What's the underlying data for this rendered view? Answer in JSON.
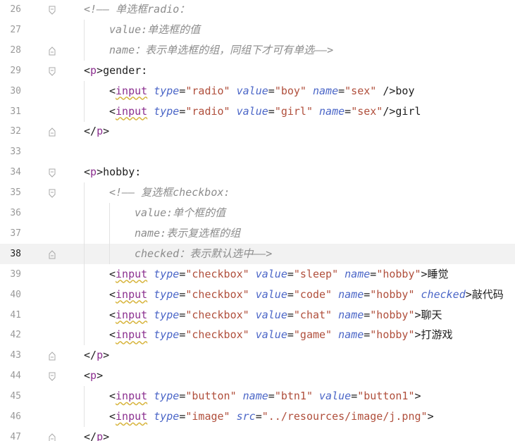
{
  "editor": {
    "current_line": 38,
    "lines": [
      {
        "number": 26,
        "indent": 1,
        "fold": "start",
        "tokens": [
          [
            "c",
            "<!—— 单选框radio："
          ]
        ]
      },
      {
        "number": 27,
        "indent": 2,
        "fold": "",
        "tokens": [
          [
            "c",
            "value:单选框的值"
          ]
        ]
      },
      {
        "number": 28,
        "indent": 2,
        "fold": "end",
        "tokens": [
          [
            "c",
            "name：表示单选框的组，同组下才可有单选——>"
          ]
        ]
      },
      {
        "number": 29,
        "indent": 1,
        "fold": "start",
        "tokens": [
          [
            "b",
            "<"
          ],
          [
            "p",
            "p"
          ],
          [
            "b",
            ">gender:"
          ]
        ]
      },
      {
        "number": 30,
        "indent": 2,
        "fold": "",
        "tokens": [
          [
            "b",
            "<"
          ],
          [
            "i",
            "input"
          ],
          [
            "s",
            " "
          ],
          [
            "a",
            "type"
          ],
          [
            "e",
            "="
          ],
          [
            "v",
            "\"radio\""
          ],
          [
            "s",
            " "
          ],
          [
            "a",
            "value"
          ],
          [
            "e",
            "="
          ],
          [
            "v",
            "\"boy\""
          ],
          [
            "s",
            " "
          ],
          [
            "a",
            "name"
          ],
          [
            "e",
            "="
          ],
          [
            "v",
            "\"sex\""
          ],
          [
            "s",
            " "
          ],
          [
            "b",
            "/>boy"
          ]
        ]
      },
      {
        "number": 31,
        "indent": 2,
        "fold": "",
        "tokens": [
          [
            "b",
            "<"
          ],
          [
            "i",
            "input"
          ],
          [
            "s",
            " "
          ],
          [
            "a",
            "type"
          ],
          [
            "e",
            "="
          ],
          [
            "v",
            "\"radio\""
          ],
          [
            "s",
            " "
          ],
          [
            "a",
            "value"
          ],
          [
            "e",
            "="
          ],
          [
            "v",
            "\"girl\""
          ],
          [
            "s",
            " "
          ],
          [
            "a",
            "name"
          ],
          [
            "e",
            "="
          ],
          [
            "v",
            "\"sex\""
          ],
          [
            "b",
            "/>girl"
          ]
        ]
      },
      {
        "number": 32,
        "indent": 1,
        "fold": "end",
        "tokens": [
          [
            "b",
            "</"
          ],
          [
            "p",
            "p"
          ],
          [
            "b",
            ">"
          ]
        ]
      },
      {
        "number": 33,
        "indent": 0,
        "fold": "",
        "tokens": []
      },
      {
        "number": 34,
        "indent": 1,
        "fold": "start",
        "tokens": [
          [
            "b",
            "<"
          ],
          [
            "p",
            "p"
          ],
          [
            "b",
            ">hobby:"
          ]
        ]
      },
      {
        "number": 35,
        "indent": 2,
        "fold": "start",
        "tokens": [
          [
            "c",
            "<!—— 复选框checkbox:"
          ]
        ]
      },
      {
        "number": 36,
        "indent": 3,
        "fold": "",
        "tokens": [
          [
            "c",
            "value:单个框的值"
          ]
        ]
      },
      {
        "number": 37,
        "indent": 3,
        "fold": "",
        "tokens": [
          [
            "c",
            "name:表示复选框的组"
          ]
        ]
      },
      {
        "number": 38,
        "indent": 3,
        "fold": "end",
        "tokens": [
          [
            "c",
            "checked：表示默认选中——>"
          ]
        ]
      },
      {
        "number": 39,
        "indent": 2,
        "fold": "",
        "tokens": [
          [
            "b",
            "<"
          ],
          [
            "i",
            "input"
          ],
          [
            "s",
            " "
          ],
          [
            "a",
            "type"
          ],
          [
            "e",
            "="
          ],
          [
            "v",
            "\"checkbox\""
          ],
          [
            "s",
            " "
          ],
          [
            "a",
            "value"
          ],
          [
            "e",
            "="
          ],
          [
            "v",
            "\"sleep\""
          ],
          [
            "s",
            " "
          ],
          [
            "a",
            "name"
          ],
          [
            "e",
            "="
          ],
          [
            "v",
            "\"hobby\""
          ],
          [
            "b",
            ">睡觉"
          ]
        ]
      },
      {
        "number": 40,
        "indent": 2,
        "fold": "",
        "tokens": [
          [
            "b",
            "<"
          ],
          [
            "i",
            "input"
          ],
          [
            "s",
            " "
          ],
          [
            "a",
            "type"
          ],
          [
            "e",
            "="
          ],
          [
            "v",
            "\"checkbox\""
          ],
          [
            "s",
            " "
          ],
          [
            "a",
            "value"
          ],
          [
            "e",
            "="
          ],
          [
            "v",
            "\"code\""
          ],
          [
            "s",
            " "
          ],
          [
            "a",
            "name"
          ],
          [
            "e",
            "="
          ],
          [
            "v",
            "\"hobby\""
          ],
          [
            "s",
            " "
          ],
          [
            "a",
            "checked"
          ],
          [
            "b",
            ">敲代码"
          ]
        ]
      },
      {
        "number": 41,
        "indent": 2,
        "fold": "",
        "tokens": [
          [
            "b",
            "<"
          ],
          [
            "i",
            "input"
          ],
          [
            "s",
            " "
          ],
          [
            "a",
            "type"
          ],
          [
            "e",
            "="
          ],
          [
            "v",
            "\"checkbox\""
          ],
          [
            "s",
            " "
          ],
          [
            "a",
            "value"
          ],
          [
            "e",
            "="
          ],
          [
            "v",
            "\"chat\""
          ],
          [
            "s",
            " "
          ],
          [
            "a",
            "name"
          ],
          [
            "e",
            "="
          ],
          [
            "v",
            "\"hobby\""
          ],
          [
            "b",
            ">聊天"
          ]
        ]
      },
      {
        "number": 42,
        "indent": 2,
        "fold": "",
        "tokens": [
          [
            "b",
            "<"
          ],
          [
            "i",
            "input"
          ],
          [
            "s",
            " "
          ],
          [
            "a",
            "type"
          ],
          [
            "e",
            "="
          ],
          [
            "v",
            "\"checkbox\""
          ],
          [
            "s",
            " "
          ],
          [
            "a",
            "value"
          ],
          [
            "e",
            "="
          ],
          [
            "v",
            "\"game\""
          ],
          [
            "s",
            " "
          ],
          [
            "a",
            "name"
          ],
          [
            "e",
            "="
          ],
          [
            "v",
            "\"hobby\""
          ],
          [
            "b",
            ">打游戏"
          ]
        ]
      },
      {
        "number": 43,
        "indent": 1,
        "fold": "end",
        "tokens": [
          [
            "b",
            "</"
          ],
          [
            "p",
            "p"
          ],
          [
            "b",
            ">"
          ]
        ]
      },
      {
        "number": 44,
        "indent": 1,
        "fold": "start",
        "tokens": [
          [
            "b",
            "<"
          ],
          [
            "p",
            "p"
          ],
          [
            "b",
            ">"
          ]
        ]
      },
      {
        "number": 45,
        "indent": 2,
        "fold": "",
        "tokens": [
          [
            "b",
            "<"
          ],
          [
            "i",
            "input"
          ],
          [
            "s",
            " "
          ],
          [
            "a",
            "type"
          ],
          [
            "e",
            "="
          ],
          [
            "v",
            "\"button\""
          ],
          [
            "s",
            " "
          ],
          [
            "a",
            "name"
          ],
          [
            "e",
            "="
          ],
          [
            "v",
            "\"btn1\""
          ],
          [
            "s",
            " "
          ],
          [
            "a",
            "value"
          ],
          [
            "e",
            "="
          ],
          [
            "v",
            "\"button1\""
          ],
          [
            "b",
            ">"
          ]
        ]
      },
      {
        "number": 46,
        "indent": 2,
        "fold": "",
        "tokens": [
          [
            "b",
            "<"
          ],
          [
            "i",
            "input"
          ],
          [
            "s",
            " "
          ],
          [
            "a",
            "type"
          ],
          [
            "e",
            "="
          ],
          [
            "v",
            "\"image\""
          ],
          [
            "s",
            " "
          ],
          [
            "a",
            "src"
          ],
          [
            "e",
            "="
          ],
          [
            "v",
            "\"../resources/image/j.png\""
          ],
          [
            "b",
            ">"
          ]
        ]
      },
      {
        "number": 47,
        "indent": 1,
        "fold": "end",
        "tokens": [
          [
            "b",
            "</"
          ],
          [
            "p",
            "p"
          ],
          [
            "b",
            ">"
          ]
        ]
      }
    ]
  },
  "colors": {
    "background": "#ffffff",
    "current_line_background": "#f2f2f2",
    "line_number": "#9a9a9a",
    "tag_name": "#8b2f8f",
    "attribute": "#4b66c7",
    "string": "#b04f3c",
    "comment": "#8c8c8c",
    "text": "#1e1e1e"
  }
}
